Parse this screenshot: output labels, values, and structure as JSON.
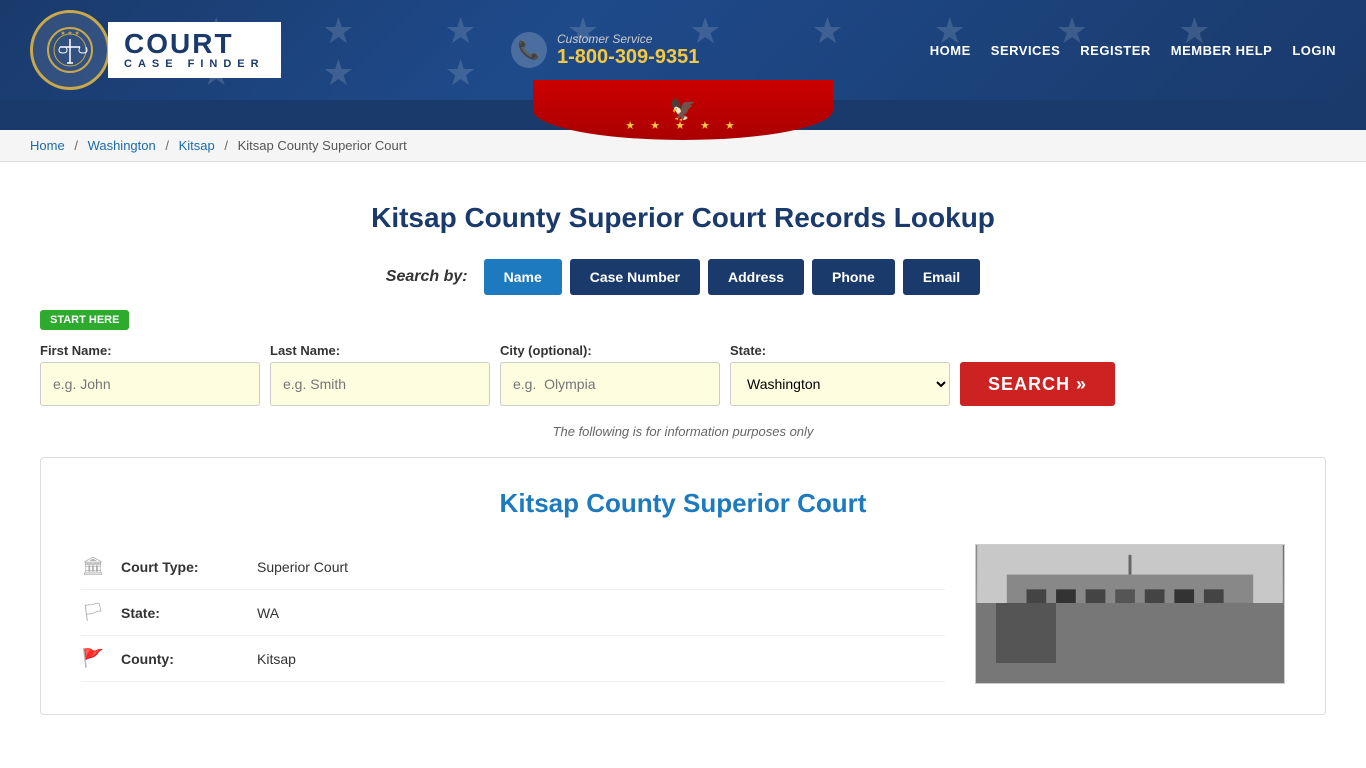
{
  "header": {
    "customer_service_label": "Customer Service",
    "phone": "1-800-309-9351",
    "nav": {
      "home": "HOME",
      "services": "SERVICES",
      "register": "REGISTER",
      "member_help": "MEMBER HELP",
      "login": "LOGIN"
    },
    "logo": {
      "court_text": "COURT",
      "case_finder_text": "CASE FINDER"
    }
  },
  "breadcrumb": {
    "home": "Home",
    "state": "Washington",
    "county": "Kitsap",
    "current": "Kitsap County Superior Court"
  },
  "page": {
    "title": "Kitsap County Superior Court Records Lookup",
    "search_by_label": "Search by:",
    "search_tabs": [
      "Name",
      "Case Number",
      "Address",
      "Phone",
      "Email"
    ],
    "active_tab": "Name",
    "start_here": "START HERE",
    "form": {
      "first_name_label": "First Name:",
      "first_name_placeholder": "e.g. John",
      "last_name_label": "Last Name:",
      "last_name_placeholder": "e.g. Smith",
      "city_label": "City (optional):",
      "city_placeholder": "e.g.  Olympia",
      "state_label": "State:",
      "state_value": "Washington",
      "search_button": "SEARCH »"
    },
    "info_text": "The following is for information purposes only",
    "court": {
      "title": "Kitsap County Superior Court",
      "court_type_label": "Court Type:",
      "court_type_value": "Superior Court",
      "state_label": "State:",
      "state_value": "WA",
      "county_label": "County:",
      "county_value": "Kitsap"
    }
  }
}
